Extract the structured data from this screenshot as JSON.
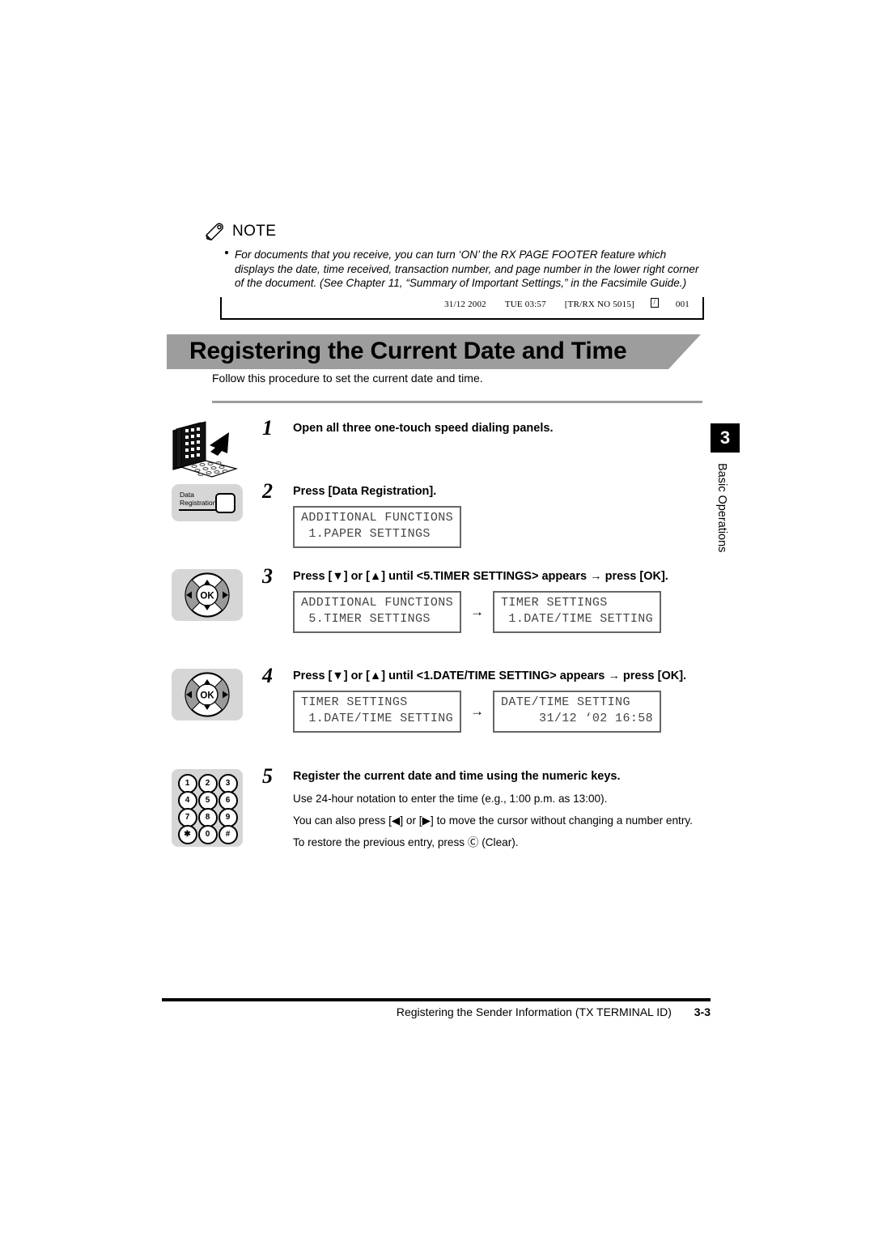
{
  "note": {
    "icon": "pencil-icon",
    "title": "NOTE",
    "text": "For documents that you receive, you can turn ‘ON’ the RX PAGE FOOTER feature which displays the date, time received, transaction number, and page number in the lower right corner of the document. (See Chapter 11, “Summary of Important Settings,” in the Facsimile Guide.)"
  },
  "fax_footer_sample": {
    "date": "31/12 2002",
    "day_time": "TUE 03:57",
    "transaction_prefix": "[TR/RX NO 5015]",
    "page_number": "001"
  },
  "banner": {
    "title": "Registering the Current Date and Time",
    "bg_color": "#9d9d9d"
  },
  "intro": "Follow this procedure to set the current date and time.",
  "chapter_tab": {
    "number": "3",
    "label": "Basic Operations"
  },
  "steps": [
    {
      "number": "1",
      "icon": "speed-dial-panels-icon",
      "heading": "Open all three one-touch speed dialing panels.",
      "notes": [],
      "lcds": []
    },
    {
      "number": "2",
      "icon": "data-registration-key-icon",
      "key_label_line1": "Data",
      "key_label_line2": "Registration",
      "heading": "Press [Data Registration].",
      "notes": [],
      "lcds": [
        {
          "line1": "ADDITIONAL FUNCTIONS",
          "line2": " 1.PAPER SETTINGS"
        }
      ]
    },
    {
      "number": "3",
      "icon": "navigation-ok-key-icon",
      "heading": "Press [▼] or [▲] until <5.TIMER SETTINGS> appears → press [OK].",
      "notes": [],
      "lcds": [
        {
          "line1": "ADDITIONAL FUNCTIONS",
          "line2": " 5.TIMER SETTINGS"
        },
        {
          "line1": "TIMER SETTINGS",
          "line2": " 1.DATE/TIME SETTING"
        }
      ],
      "arrow": "→"
    },
    {
      "number": "4",
      "icon": "navigation-ok-key-icon",
      "heading": "Press [▼] or [▲] until <1.DATE/TIME SETTING> appears → press [OK].",
      "notes": [],
      "lcds": [
        {
          "line1": "TIMER SETTINGS",
          "line2": " 1.DATE/TIME SETTING"
        },
        {
          "line1": "DATE/TIME SETTING",
          "line2": "     31/12 ‘02 16:58"
        }
      ],
      "arrow": "→"
    },
    {
      "number": "5",
      "icon": "numeric-keypad-icon",
      "heading": "Register the current date and time using the numeric keys.",
      "notes": [
        "Use 24-hour notation to enter the time (e.g., 1:00 p.m. as 13:00).",
        "You can also press [◀] or [▶] to move the cursor without changing a number entry.",
        "To restore the previous entry, press Ⓒ (Clear)."
      ],
      "lcds": []
    }
  ],
  "keypad_keys": [
    "1",
    "2",
    "3",
    "4",
    "5",
    "6",
    "7",
    "8",
    "9",
    "✱",
    "0",
    "#"
  ],
  "nav_key": {
    "center_label": "OK",
    "up": "▲",
    "down": "▼",
    "left": "◀",
    "right": "▶"
  },
  "page_footer": {
    "title": "Registering the Sender Information (TX TERMINAL ID)",
    "page": "3-3"
  }
}
